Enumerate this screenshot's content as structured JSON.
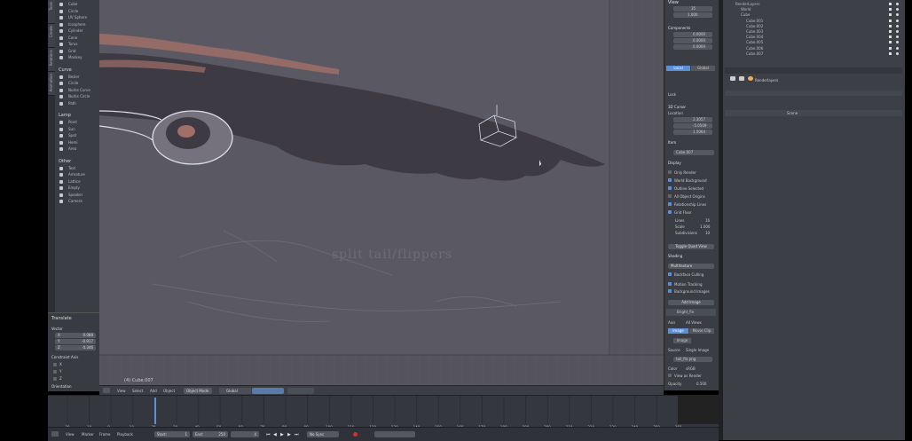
{
  "tool_shelf": {
    "tabs": [
      "Tools",
      "Create",
      "Relations",
      "Animation",
      "Physics",
      "Grease Pencil"
    ],
    "sections": [
      {
        "title": "",
        "items": [
          "Cube",
          "Circle",
          "UV Sphere",
          "Icosphere",
          "Cylinder",
          "Cone",
          "Torus",
          "Grid",
          "Monkey"
        ]
      },
      {
        "title": "Curve",
        "items": [
          "Bezier",
          "Circle",
          "Nurbs Curve",
          "Nurbs Circle",
          "Path"
        ]
      },
      {
        "title": "Lamp",
        "items": [
          "Point",
          "Sun",
          "Spot",
          "Hemi",
          "Area"
        ]
      },
      {
        "title": "Other",
        "items": [
          "Text",
          "Armature",
          "Lattice",
          "Empty",
          "Speaker",
          "Camera"
        ]
      }
    ]
  },
  "operator_panel": {
    "title": "Translate",
    "vector_label": "Vector",
    "vector": [
      {
        "axis": "X",
        "value": "0.088"
      },
      {
        "axis": "Y",
        "value": "-0.917"
      },
      {
        "axis": "Z",
        "value": "0.346"
      }
    ],
    "constraint_label": "Constraint Axis",
    "constraint_axes": [
      "X",
      "Y",
      "Z"
    ],
    "orientation_label": "Orientation"
  },
  "viewport": {
    "overlay_text": "split tail/flippers",
    "object_name": "(4) Cube.007"
  },
  "viewport_header": {
    "menus": [
      "View",
      "Select",
      "Add",
      "Object"
    ],
    "mode": "Object Mode",
    "pivot": "Global"
  },
  "properties_panel": {
    "view_label": "View",
    "lens_value": "35",
    "clip_value": "1.000",
    "components_label": "Components",
    "components": [
      "0.0000",
      "0.0000",
      "0.0000"
    ],
    "tabs": [
      "Local",
      "Global"
    ],
    "locks_label": "Lock",
    "cursor_label": "3D Cursor",
    "location_label": "Location",
    "location": [
      "2.3057",
      "-5.0509",
      "1.5064"
    ],
    "item_label": "Item",
    "item_name": "Cube.007",
    "display_label": "Display",
    "display_options": [
      {
        "label": "Only Render",
        "checked": false
      },
      {
        "label": "World Background",
        "checked": true
      },
      {
        "label": "Outline Selected",
        "checked": true
      },
      {
        "label": "All Object Origins",
        "checked": false
      },
      {
        "label": "Relationship Lines",
        "checked": true
      },
      {
        "label": "Grid Floor",
        "checked": true
      }
    ],
    "grid_lines_label": "Lines",
    "grid_lines_value": "16",
    "grid_scale_label": "Scale",
    "grid_scale_value": "1.000",
    "grid_sub_label": "Subdivisions",
    "grid_sub_value": "10",
    "toggle_quad_view": "Toggle Quad View",
    "shading_label": "Shading",
    "multitexture": "Multitexture",
    "backface_culling": "Backface Culling",
    "motion_tracking": "Motion Tracking",
    "background_images": "Background Images",
    "add_image": "Add Image",
    "image_name": "Bright_fin",
    "axis_label": "Axis",
    "axis_value": "All Views",
    "source_image": "Image",
    "source_movie": "Movie Clip",
    "image_file": "Image",
    "source_label": "Source",
    "source_value": "Single Image",
    "image_filename": "tail_fin.png",
    "color_label": "Color",
    "color_value": "sRGB",
    "view_as_render": "View as Render",
    "opacity_label": "Opacity",
    "opacity_value": "0.500"
  },
  "outliner": {
    "rows": [
      {
        "name": "RenderLayers",
        "indent": 0
      },
      {
        "name": "World",
        "indent": 1
      },
      {
        "name": "Cube",
        "indent": 1
      },
      {
        "name": "Cube.001",
        "indent": 2
      },
      {
        "name": "Cube.002",
        "indent": 2
      },
      {
        "name": "Cube.003",
        "indent": 2
      },
      {
        "name": "Cube.004",
        "indent": 2
      },
      {
        "name": "Cube.005",
        "indent": 2
      },
      {
        "name": "Cube.006",
        "indent": 2
      },
      {
        "name": "Cube.007",
        "indent": 2
      }
    ]
  },
  "property_editor": {
    "context": "Renderlayers",
    "tab_label": "Scene"
  },
  "timeline": {
    "ticks": [
      "-20",
      "-10",
      "0",
      "10",
      "20",
      "30",
      "40",
      "50",
      "60",
      "70",
      "80",
      "90",
      "100",
      "110",
      "120",
      "130",
      "140",
      "150",
      "160",
      "170",
      "180",
      "190",
      "200",
      "210",
      "220",
      "230",
      "240",
      "250",
      "260"
    ]
  },
  "bottom_bar": {
    "menus": [
      "View",
      "Marker",
      "Frame",
      "Playback"
    ],
    "start_label": "Start:",
    "start_value": "1",
    "end_label": "End:",
    "end_value": "250",
    "current_frame": "4",
    "sync": "No Sync"
  },
  "colors": {
    "viewport": "#55535c",
    "panel": "#3a3d44",
    "accent": "#5b8fd6",
    "fin_dark": "#3d3a44",
    "fin_stripe": "#a06f68"
  }
}
